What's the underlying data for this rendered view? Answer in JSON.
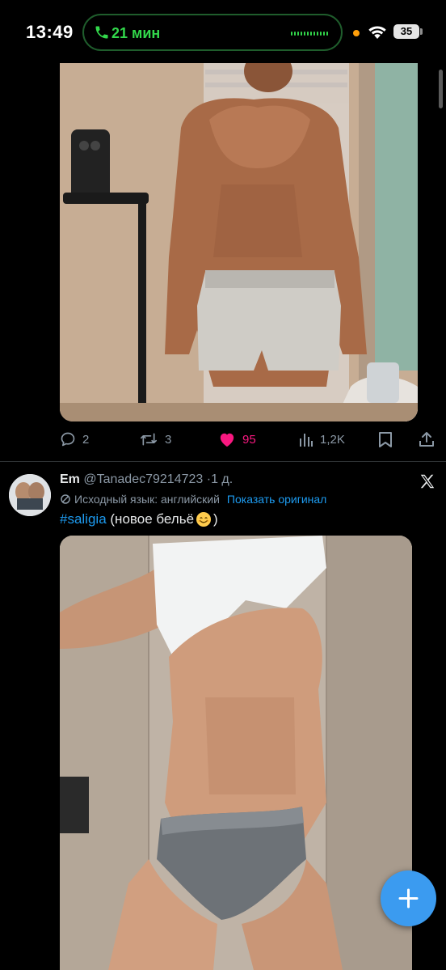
{
  "status_bar": {
    "time": "13:49",
    "call_duration": "21 мин",
    "battery_level": "35",
    "call_color": "#32d74b"
  },
  "post1": {
    "media_description_icon": "image",
    "actions": {
      "replies": "2",
      "reposts": "3",
      "likes": "95",
      "views": "1,2K"
    },
    "like_color": "#f91880"
  },
  "post2": {
    "author_name": "Em",
    "author_handle": "@Tanadec79214723",
    "time_separator": "·",
    "time": "1 д.",
    "translation_note": "Исходный язык: английский",
    "show_original": "Показать оригинал",
    "hashtag": "#saligia",
    "text_open": "(новое бельё",
    "text_close": ")",
    "emoji": "smiling-face-icon"
  },
  "compose_button": {
    "icon": "plus-icon",
    "color": "#3b9bf0"
  }
}
